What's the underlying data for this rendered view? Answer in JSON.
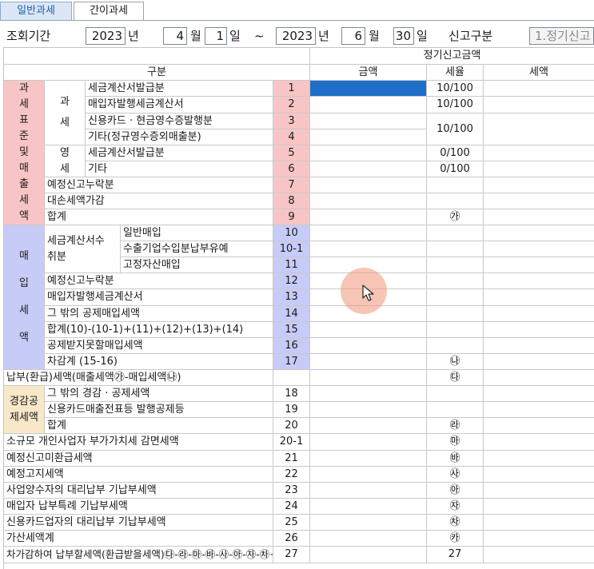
{
  "tabs": [
    "일반과세",
    "간이과세"
  ],
  "period": {
    "label": "조회기간",
    "from": {
      "year": "2023",
      "year_unit": "년",
      "month": "4",
      "month_unit": "월",
      "day": "1",
      "day_unit": "일"
    },
    "tilde": "~",
    "to": {
      "year": "2023",
      "year_unit": "년",
      "month": "6",
      "month_unit": "월",
      "day": "30",
      "day_unit": "일"
    },
    "report_type_label": "신고구분",
    "report_type_value": "1.정기신고"
  },
  "table": {
    "header_group": "정기신고금액",
    "col_category": "구분",
    "col_amount": "금액",
    "col_rate": "세율",
    "col_tax": "세액"
  },
  "sections": {
    "sales": "과세표준및매출세액",
    "taxable": "과세",
    "zero_rated": "영세",
    "purchase": "매입세액",
    "invoice_received": "세금계산서수취분",
    "reduction": "경감공제세액"
  },
  "rows": [
    {
      "label": "세금계산서발급분",
      "no": "1",
      "rate": "10/100"
    },
    {
      "label": "매입자발행세금계산서",
      "no": "2",
      "rate": "10/100"
    },
    {
      "label": "신용카드 · 현금영수증발행분",
      "no": "3",
      "rate": "10/100"
    },
    {
      "label": "기타(정규영수증외매출분)",
      "no": "4",
      "rate": ""
    },
    {
      "label": "세금계산서발급분",
      "no": "5",
      "rate": "0/100"
    },
    {
      "label": "기타",
      "no": "6",
      "rate": "0/100"
    },
    {
      "label": "예정신고누락분",
      "no": "7",
      "rate": ""
    },
    {
      "label": "대손세액가감",
      "no": "8",
      "rate": ""
    },
    {
      "label": "합계",
      "no": "9",
      "rate": "㉮"
    },
    {
      "label": "일반매입",
      "no": "10",
      "rate": ""
    },
    {
      "label": "수출기업수입분납부유예",
      "no": "10-1",
      "rate": ""
    },
    {
      "label": "고정자산매입",
      "no": "11",
      "rate": ""
    },
    {
      "label": "예정신고누락분",
      "no": "12",
      "rate": ""
    },
    {
      "label": "매입자발행세금계산서",
      "no": "13",
      "rate": ""
    },
    {
      "label": "그 밖의 공제매입세액",
      "no": "14",
      "rate": ""
    },
    {
      "label": "합계(10)-(10-1)+(11)+(12)+(13)+(14)",
      "no": "15",
      "rate": ""
    },
    {
      "label": "공제받지못할매입세액",
      "no": "16",
      "rate": ""
    },
    {
      "label": "차감계 (15-16)",
      "no": "17",
      "rate": "㉯"
    },
    {
      "label": "납부(환급)세액(매출세액㉮-매입세액㉯)",
      "no": "",
      "rate": "㉰"
    },
    {
      "label": "그 밖의 경감 · 공제세액",
      "no": "18",
      "rate": ""
    },
    {
      "label": "신용카드매출전표등 발행공제등",
      "no": "19",
      "rate": ""
    },
    {
      "label": "합계",
      "no": "20",
      "rate": "㉱"
    },
    {
      "label": "소규모 개인사업자 부가가치세 감면세액",
      "no": "20-1",
      "rate": "㉲"
    },
    {
      "label": "예정신고미환급세액",
      "no": "21",
      "rate": "㉳"
    },
    {
      "label": "예정고지세액",
      "no": "22",
      "rate": "㉴"
    },
    {
      "label": "사업양수자의 대리납부 기납부세액",
      "no": "23",
      "rate": "㉵"
    },
    {
      "label": "매입자 납부특례 기납부세액",
      "no": "24",
      "rate": "㉶"
    },
    {
      "label": "신용카드업자의 대리납부 기납부세액",
      "no": "25",
      "rate": "㉷"
    },
    {
      "label": "가산세액계",
      "no": "26",
      "rate": "㉸"
    },
    {
      "label": "차가감하여 납부할세액(환급받을세액)㉰-㉱-㉲-㉳-㉴-㉵-㉶-㉷+㉸",
      "no": "27",
      "rate": ""
    }
  ]
}
